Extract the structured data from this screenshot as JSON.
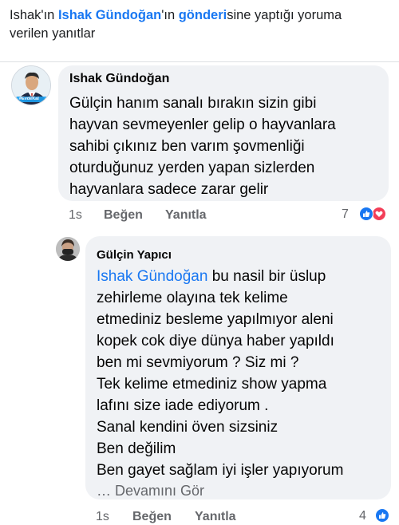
{
  "header": {
    "prefix": "Ishak'ın ",
    "name_link": "Ishak Gündoğan",
    "possessive": "'ın ",
    "post_link": "gönderi",
    "rest_line1": "sine yaptığı yoruma",
    "rest_line2": "verilen yanıtlar"
  },
  "comments": [
    {
      "author": "Ishak Gündoğan",
      "avatar_badge": "#EvdeKal",
      "lines": [
        "Gülçin hanım sanalı bırakın sizin gibi",
        "hayvan sevmeyenler gelip o hayvanlara",
        "sahibi çıkınız ben varım şovmenliği",
        "oturduğunuz yerden yapan sizlerden",
        "hayvanlara sadece zarar gelir"
      ],
      "time": "1s",
      "like_label": "Beğen",
      "reply_label": "Yanıtla",
      "reaction_count": "7",
      "reaction_icons": [
        "like-icon",
        "love-icon"
      ],
      "colors": {
        "like": "#1877f2",
        "love": "#f33e58"
      }
    },
    {
      "author": "Gülçin Yapıcı",
      "mention": "Ishak Gündoğan",
      "first_line_rest": " bu nasil bir üslup",
      "lines": [
        "zehirleme olayına tek kelime",
        "etmediniz besleme yapılmıyor aleni",
        "kopek cok diye dünya haber yapıldı",
        "ben mi sevmiyorum ? Siz mi ?",
        "Tek kelime etmediniz show yapma",
        "lafını size iade ediyorum .",
        "Sanal kendini öven sizsiniz",
        "Ben değilim",
        "Ben gayet sağlam iyi işler yapıyorum"
      ],
      "see_more": "… Devamını Gör",
      "time": "1s",
      "like_label": "Beğen",
      "reply_label": "Yanıtla",
      "reaction_count": "4",
      "reaction_icons": [
        "like-icon"
      ]
    }
  ],
  "colors": {
    "link": "#1877f2",
    "muted": "#65676b",
    "bubble": "#f0f2f5"
  }
}
